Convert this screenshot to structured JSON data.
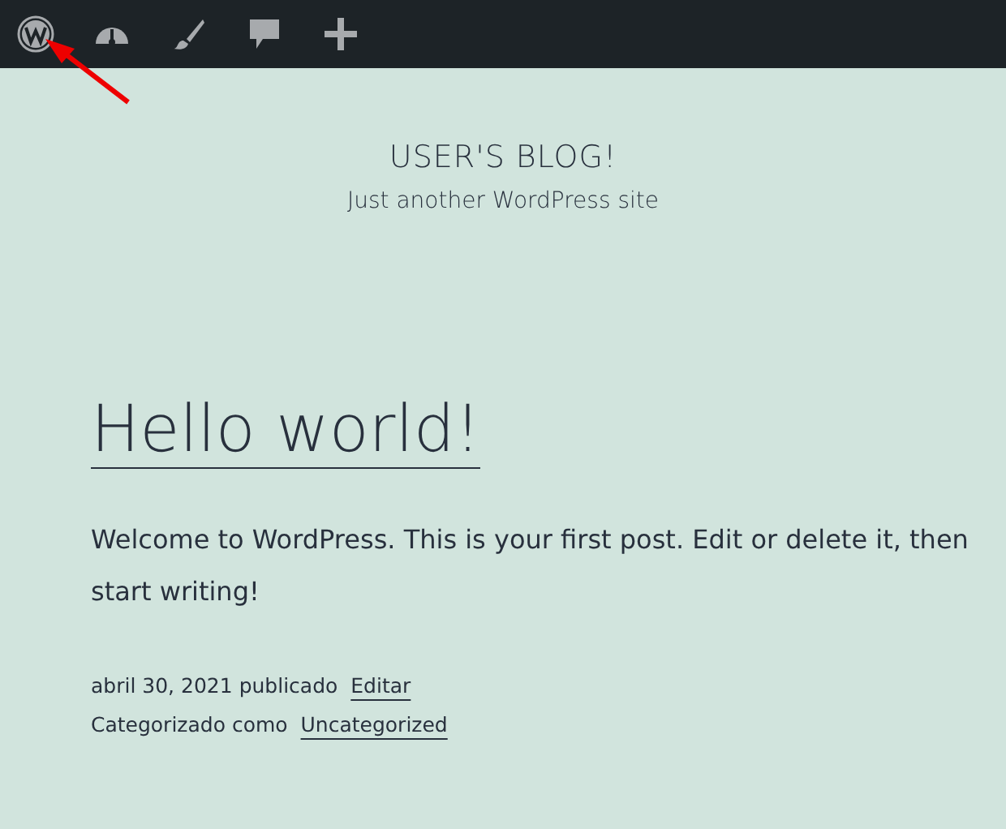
{
  "admin_bar": {
    "items": [
      {
        "kind": "logo"
      },
      {
        "kind": "dashboard"
      },
      {
        "kind": "customize"
      },
      {
        "kind": "comments"
      },
      {
        "kind": "new"
      }
    ]
  },
  "site": {
    "title": "USER'S BLOG!",
    "tagline": "Just another WordPress site"
  },
  "post": {
    "title": "Hello world!",
    "content": "Welcome to WordPress. This is your first post. Edit or delete it, then start writing!",
    "date": "abril 30, 2021",
    "published_label": "publicado",
    "edit_link": "Editar",
    "category_label": "Categorizado como",
    "category": "Uncategorized"
  }
}
